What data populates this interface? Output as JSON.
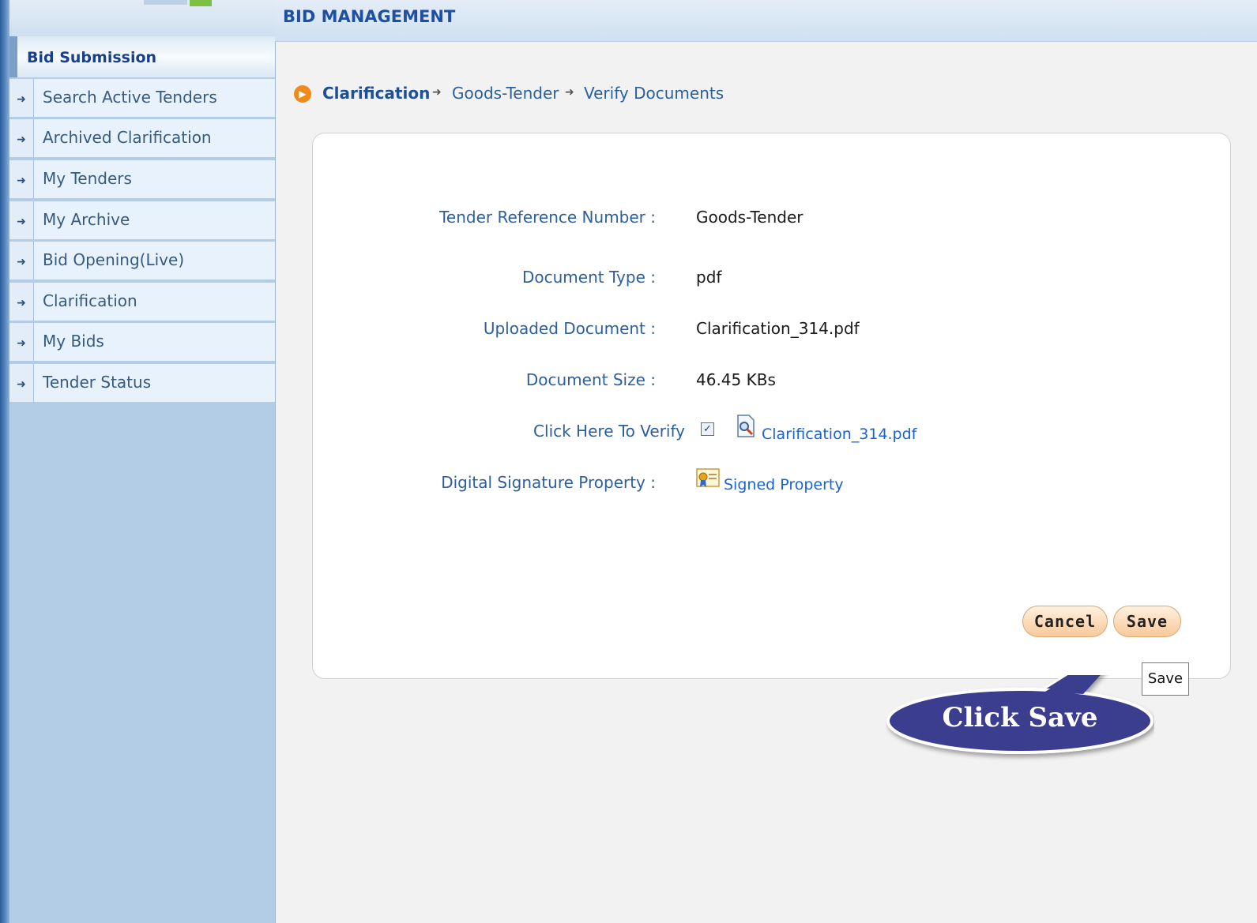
{
  "header": {
    "title": "BID MANAGEMENT"
  },
  "sidebar": {
    "section_title": "Bid Submission",
    "items": [
      {
        "label": "Search Active Tenders"
      },
      {
        "label": "Archived Clarification"
      },
      {
        "label": "My Tenders"
      },
      {
        "label": "My Archive"
      },
      {
        "label": "Bid Opening(Live)"
      },
      {
        "label": "Clarification"
      },
      {
        "label": "My Bids"
      },
      {
        "label": "Tender Status"
      }
    ]
  },
  "breadcrumb": [
    "Clarification",
    "Goods-Tender",
    "Verify Documents"
  ],
  "form": {
    "tender_ref_label": "Tender Reference Number :",
    "tender_ref_value": "Goods-Tender",
    "doc_type_label": "Document Type :",
    "doc_type_value": "pdf",
    "uploaded_label": "Uploaded Document :",
    "uploaded_value": "Clarification_314.pdf",
    "size_label": "Document Size :",
    "size_value": "46.45  KBs",
    "verify_label": "Click Here To Verify",
    "verify_checked": true,
    "verify_link": "Clarification_314.pdf",
    "signature_label": "Digital Signature Property :",
    "signature_link": "Signed Property"
  },
  "buttons": {
    "cancel": "Cancel",
    "save": "Save"
  },
  "tooltip": "Save",
  "callout": "Click Save",
  "colors": {
    "accent": "#2c5f9e",
    "callout": "#3a3c8e",
    "button": "#f8c99a"
  }
}
